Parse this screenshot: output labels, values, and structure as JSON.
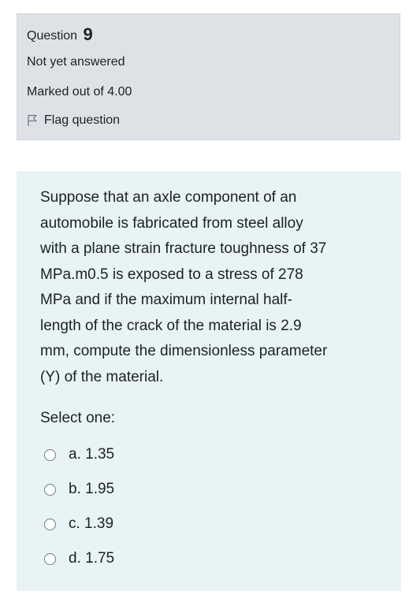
{
  "info": {
    "question_label": "Question",
    "question_number": "9",
    "state": "Not yet answered",
    "marks": "Marked out of 4.00",
    "flag_label": "Flag question"
  },
  "question": {
    "text_lines": [
      "Suppose that an axle component of an",
      "automobile is fabricated from steel alloy",
      "with a plane strain fracture toughness of 37",
      "MPa.m0.5 is exposed to a stress of 278",
      "MPa and if the maximum internal half-",
      "length of the crack of the material is 2.9",
      "mm, compute the dimensionless parameter",
      "(Y) of the material."
    ],
    "prompt": "Select one:",
    "options": [
      {
        "label": "a. 1.35"
      },
      {
        "label": "b. 1.95"
      },
      {
        "label": "c. 1.39"
      },
      {
        "label": "d. 1.75"
      }
    ]
  },
  "colors": {
    "info_bg": "#dee2e6",
    "content_bg": "#e7f3f5",
    "text": "#1d2125"
  }
}
